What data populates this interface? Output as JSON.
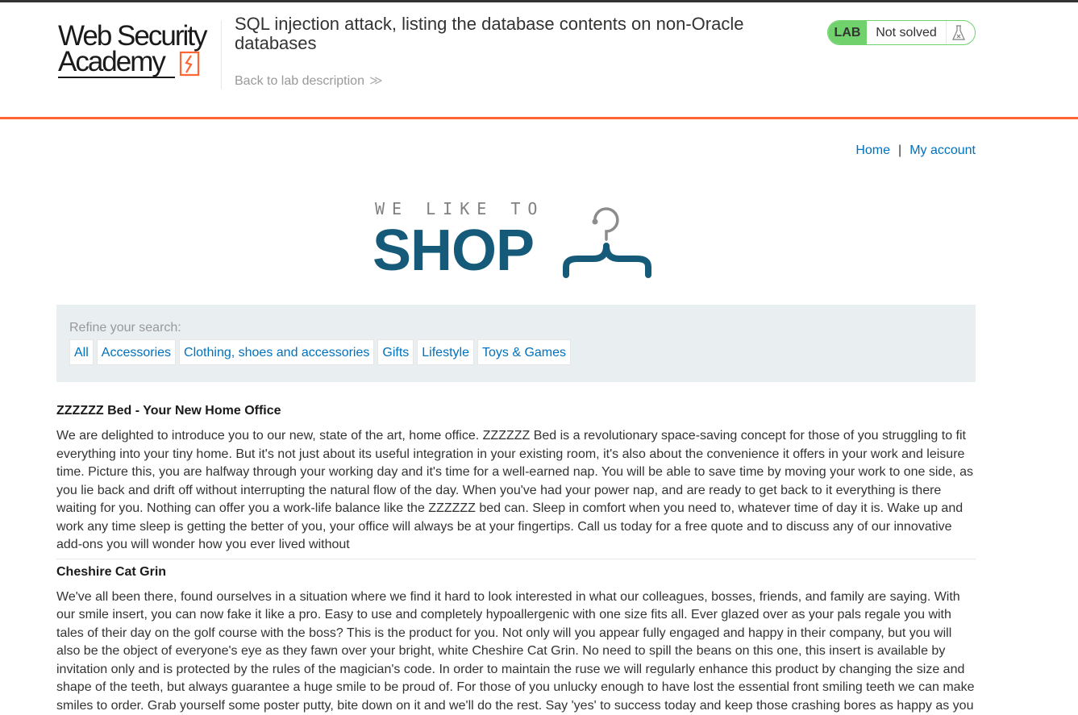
{
  "academy": {
    "logo_line1": "Web Security",
    "logo_line2": "Academy",
    "lab_title": "SQL injection attack, listing the database contents on non-Oracle databases",
    "back_link": "Back to lab description",
    "back_chevron": "≫",
    "status_label": "LAB",
    "status_text": "Not solved",
    "status_icon": "flask-icon",
    "accent_color": "#ff6633",
    "status_color": "#70d16d"
  },
  "nav": {
    "home": "Home",
    "separator": "|",
    "my_account": "My account"
  },
  "banner": {
    "tagline": "WE LIKE TO",
    "word": "SHOP",
    "icon": "hanger-icon",
    "brand_color": "#155a78"
  },
  "filters": {
    "label": "Refine your search:",
    "items": [
      "All",
      "Accessories",
      "Clothing, shoes and accessories",
      "Gifts",
      "Lifestyle",
      "Toys & Games"
    ]
  },
  "posts": [
    {
      "title": "ZZZZZZ Bed - Your New Home Office",
      "body": "We are delighted to introduce you to our new, state of the art, home office. ZZZZZZ Bed is a revolutionary space-saving concept for those of you struggling to fit everything into your tiny home. But it's not just about its useful integration in your existing room, it's also about the convenience it offers in your work and leisure time. Picture this, you are halfway through your working day and it's time for a well-earned nap. You will be able to save time by moving your work to one side, as you lie back and drift off without interrupting the natural flow of the day. When you've had your power nap, and are ready to get back to it everything is there waiting for you. Nothing can offer you a work-life balance like the ZZZZZZ bed can. Sleep in comfort when you need to, whatever time of day it is. Wake up and work any time sleep is getting the better of you, your office will always be at your fingertips. Call us today for a free quote and to discuss any of our innovative add-ons you will wonder how you ever lived without"
    },
    {
      "title": "Cheshire Cat Grin",
      "body": "We've all been there, found ourselves in a situation where we find it hard to look interested in what our colleagues, bosses, friends, and family are saying. With our smile insert, you can now fake it like a pro. Easy to use and completely hypoallergenic with one size fits all. Ever glazed over as your pals regale you with tales of their day on the golf course with the boss? This is the product for you. Not only will you appear fully engaged and happy in their company, but you will also be the object of everyone's eye as they fawn over your bright, white Cheshire Cat Grin. No need to spill the beans on this one, this insert is available by invitation only and is protected by the rules of the magician's code. In order to maintain the ruse we will regularly enhance this product by changing the size and shape of the teeth, but always guarantee a huge smile to be proud of. For those of you unlucky enough to have lost the essential front smiling teeth we can make smiles to order. Grab yourself some poster putty, bite down on it and we'll do the rest. Say 'yes' to success today and keep those crashing bores as happy as you"
    }
  ]
}
